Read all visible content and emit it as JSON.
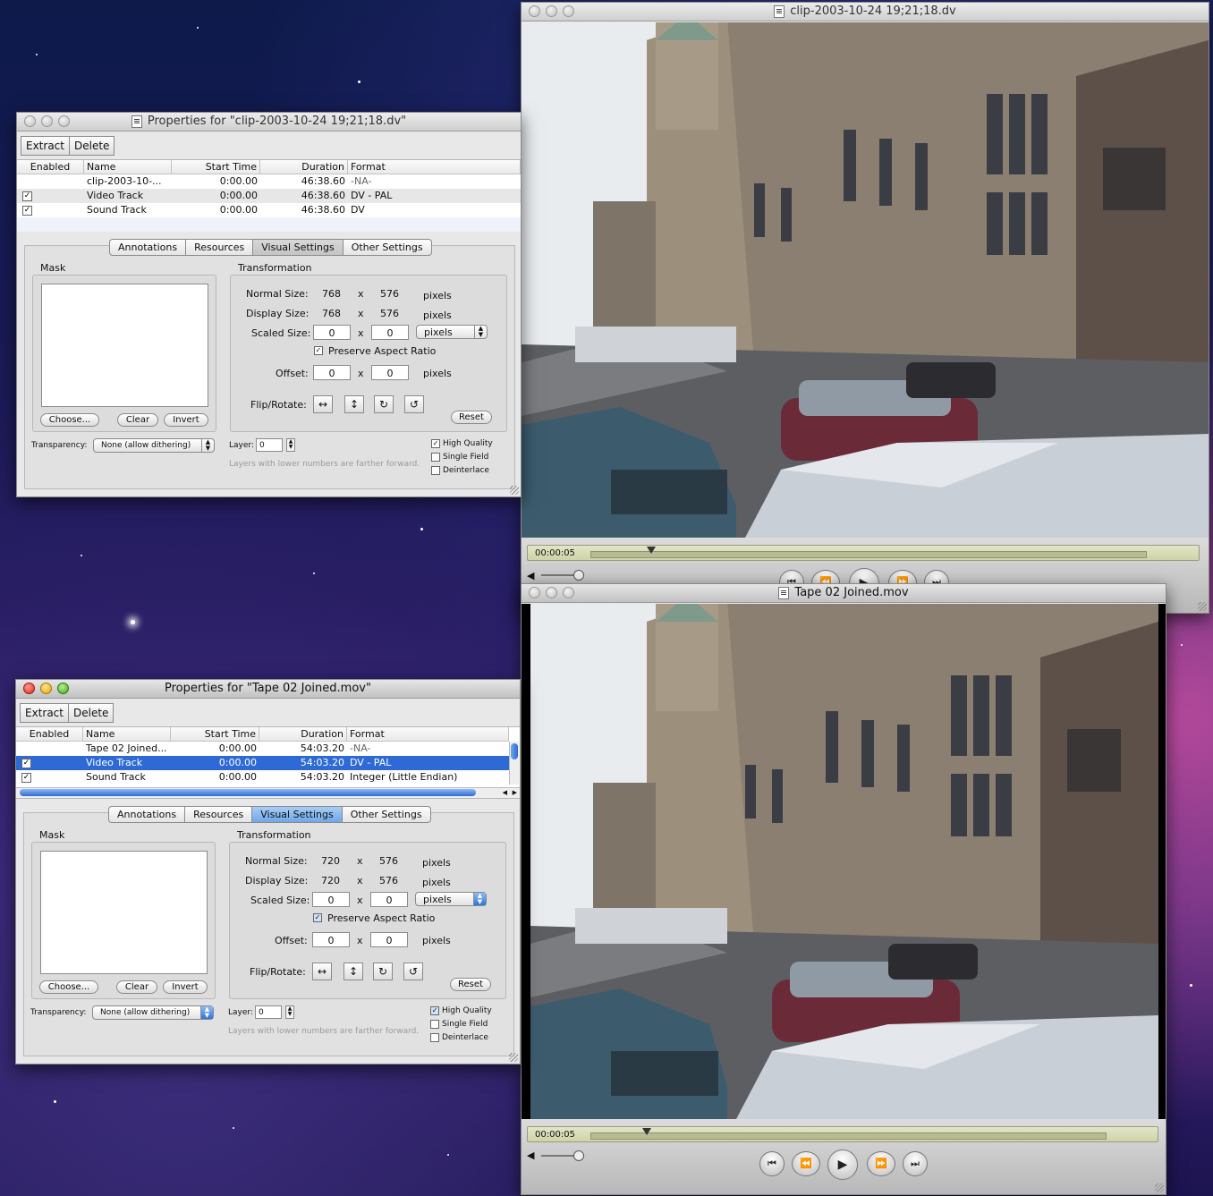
{
  "desktop": {
    "background": "space-nebula"
  },
  "properties_windows": [
    {
      "title": "Properties for \"clip-2003-10-24 19;21;18.dv\"",
      "toolbar": {
        "extract": "Extract",
        "delete": "Delete"
      },
      "columns": {
        "enabled": "Enabled",
        "name": "Name",
        "start": "Start Time",
        "duration": "Duration",
        "format": "Format"
      },
      "rows": [
        {
          "enabled": "",
          "name": "clip-2003-10-...",
          "start": "0:00.00",
          "duration": "46:38.60",
          "format": "-NA-"
        },
        {
          "enabled": "✓",
          "name": "Video Track",
          "start": "0:00.00",
          "duration": "46:38.60",
          "format": "DV - PAL"
        },
        {
          "enabled": "✓",
          "name": "Sound Track",
          "start": "0:00.00",
          "duration": "46:38.60",
          "format": "DV"
        }
      ],
      "tabs": [
        "Annotations",
        "Resources",
        "Visual Settings",
        "Other Settings"
      ],
      "mask": {
        "label": "Mask",
        "choose": "Choose...",
        "clear": "Clear",
        "invert": "Invert"
      },
      "transformation": {
        "label": "Transformation",
        "normal_label": "Normal Size:",
        "normal_w": "768",
        "normal_h": "576",
        "display_label": "Display Size:",
        "display_w": "768",
        "display_h": "576",
        "scaled_label": "Scaled Size:",
        "scaled_w": "0",
        "scaled_h": "0",
        "x": "x",
        "units": "pixels",
        "unit_popup": "pixels",
        "preserve": "Preserve Aspect Ratio",
        "preserve_checked": "✓",
        "offset_label": "Offset:",
        "offset_x": "0",
        "offset_y": "0",
        "flip_label": "Flip/Rotate:",
        "reset": "Reset"
      },
      "transparency": {
        "label": "Transparency:",
        "value": "None (allow dithering)"
      },
      "layer": {
        "label": "Layer:",
        "value": "0",
        "hint": "Layers with lower numbers are farther forward."
      },
      "options": {
        "high_quality": "High Quality",
        "high_quality_checked": "✓",
        "single_field": "Single Field",
        "deinterlace": "Deinterlace"
      }
    },
    {
      "title": "Properties for \"Tape 02 Joined.mov\"",
      "toolbar": {
        "extract": "Extract",
        "delete": "Delete"
      },
      "columns": {
        "enabled": "Enabled",
        "name": "Name",
        "start": "Start Time",
        "duration": "Duration",
        "format": "Format"
      },
      "rows": [
        {
          "enabled": "",
          "name": "Tape 02 Joined...",
          "start": "0:00.00",
          "duration": "54:03.20",
          "format": "-NA-"
        },
        {
          "enabled": "✓",
          "name": "Video Track",
          "start": "0:00.00",
          "duration": "54:03.20",
          "format": "DV - PAL"
        },
        {
          "enabled": "✓",
          "name": "Sound Track",
          "start": "0:00.00",
          "duration": "54:03.20",
          "format": "Integer (Little Endian)"
        }
      ],
      "tabs": [
        "Annotations",
        "Resources",
        "Visual Settings",
        "Other Settings"
      ],
      "mask": {
        "label": "Mask",
        "choose": "Choose...",
        "clear": "Clear",
        "invert": "Invert"
      },
      "transformation": {
        "label": "Transformation",
        "normal_label": "Normal Size:",
        "normal_w": "720",
        "normal_h": "576",
        "display_label": "Display Size:",
        "display_w": "720",
        "display_h": "576",
        "scaled_label": "Scaled Size:",
        "scaled_w": "0",
        "scaled_h": "0",
        "x": "x",
        "units": "pixels",
        "unit_popup": "pixels",
        "preserve": "Preserve Aspect Ratio",
        "preserve_checked": "✓",
        "offset_label": "Offset:",
        "offset_x": "0",
        "offset_y": "0",
        "flip_label": "Flip/Rotate:",
        "reset": "Reset"
      },
      "transparency": {
        "label": "Transparency:",
        "value": "None (allow dithering)"
      },
      "layer": {
        "label": "Layer:",
        "value": "0",
        "hint": "Layers with lower numbers are farther forward."
      },
      "options": {
        "high_quality": "High Quality",
        "high_quality_checked": "✓",
        "single_field": "Single Field",
        "deinterlace": "Deinterlace"
      }
    }
  ],
  "player_windows": [
    {
      "title": "clip-2003-10-24 19;21;18.dv",
      "timecode": "00:00:05",
      "playhead_fraction": 0.11
    },
    {
      "title": "Tape 02 Joined.mov",
      "timecode": "00:00:05",
      "playhead_fraction": 0.11
    }
  ],
  "transport_icons": [
    "go-to-start-icon",
    "rewind-icon",
    "play-icon",
    "fast-forward-icon",
    "go-to-end-icon"
  ]
}
